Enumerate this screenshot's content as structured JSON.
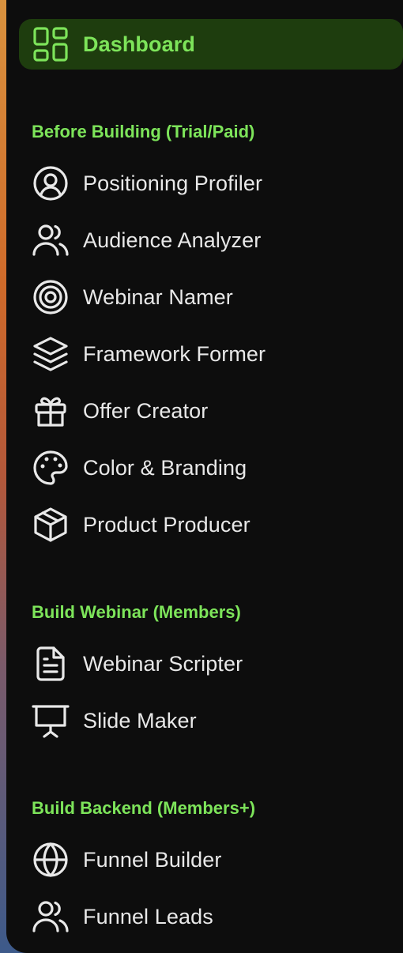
{
  "sidebar": {
    "dashboard": {
      "label": "Dashboard",
      "icon": "grid-icon"
    },
    "sections": [
      {
        "title": "Before Building (Trial/Paid)",
        "items": [
          {
            "label": "Positioning Profiler",
            "icon": "user-circle-icon"
          },
          {
            "label": "Audience Analyzer",
            "icon": "users-icon"
          },
          {
            "label": "Webinar Namer",
            "icon": "target-icon"
          },
          {
            "label": "Framework Former",
            "icon": "layers-icon"
          },
          {
            "label": "Offer Creator",
            "icon": "gift-icon"
          },
          {
            "label": "Color & Branding",
            "icon": "palette-icon"
          },
          {
            "label": "Product Producer",
            "icon": "box-icon"
          }
        ]
      },
      {
        "title": "Build Webinar (Members)",
        "items": [
          {
            "label": "Webinar Scripter",
            "icon": "document-icon"
          },
          {
            "label": "Slide Maker",
            "icon": "presentation-icon"
          }
        ]
      },
      {
        "title": "Build Backend (Members+)",
        "items": [
          {
            "label": "Funnel Builder",
            "icon": "globe-icon"
          },
          {
            "label": "Funnel Leads",
            "icon": "users-icon"
          }
        ]
      }
    ]
  },
  "colors": {
    "accent": "#7de45a",
    "active_bg": "#1e3d0e",
    "sidebar_bg": "#0d0d0d",
    "text": "#e8e8e8"
  }
}
